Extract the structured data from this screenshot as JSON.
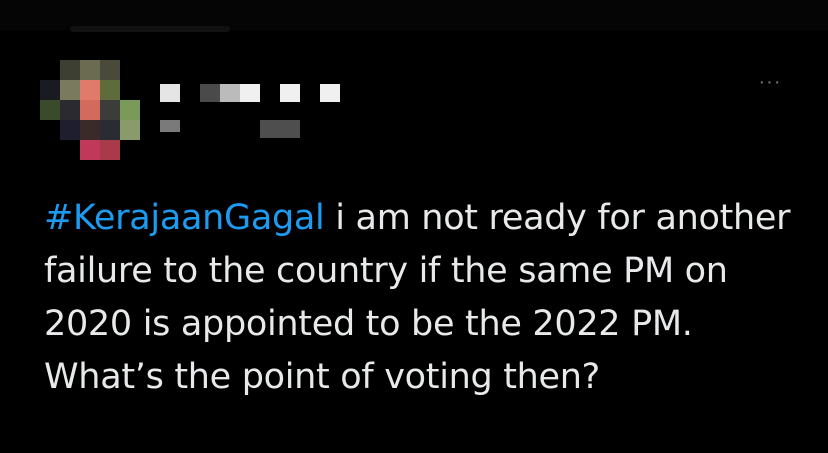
{
  "tweet": {
    "hashtag": "#KerajaanGagal",
    "text": " i am not ready for another failure to the country if the same PM on 2020 is appointed to be the 2022 PM. What’s the point of voting then?"
  },
  "actions": {
    "more_label": "···",
    "more_icon": "ellipsis-icon"
  },
  "colors": {
    "background": "#000000",
    "text": "#e7e9ea",
    "hashtag": "#1d9bf0",
    "muted": "#71767b"
  }
}
